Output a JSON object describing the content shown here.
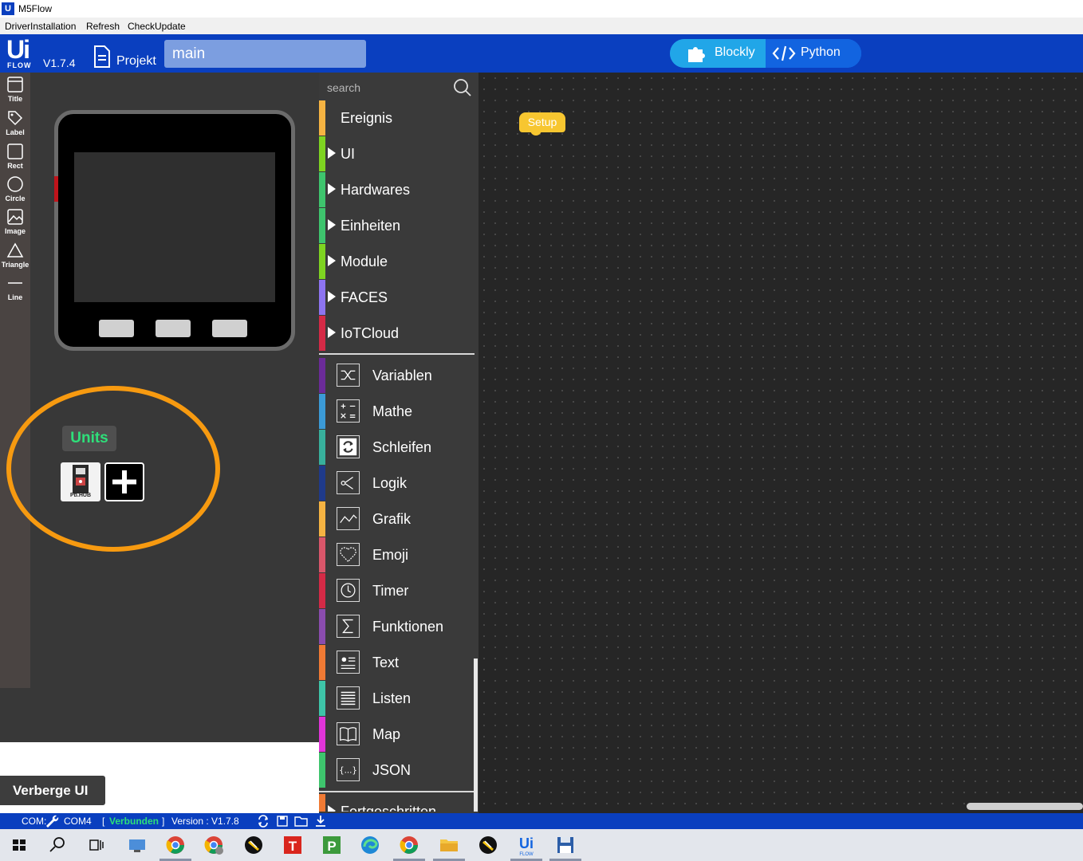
{
  "window": {
    "title": "M5Flow",
    "logo_text": "U"
  },
  "menu": {
    "items": [
      "DriverInstallation",
      "Refresh",
      "CheckUpdate"
    ]
  },
  "header": {
    "logo_big": "Ui",
    "logo_small": "FLOW",
    "version": "V1.7.4",
    "project_label": "Projekt",
    "filename": "main",
    "mode_blockly": "Blockly",
    "mode_python": "Python",
    "active_mode": "Blockly"
  },
  "tools": [
    "Title",
    "Label",
    "Rect",
    "Circle",
    "Image",
    "Triangle",
    "Line"
  ],
  "preview": {
    "units_label": "Units",
    "unit_pbhub_label": "Pb.HUB",
    "hide_ui": "Verberge UI"
  },
  "categories": {
    "search_placeholder": "search",
    "top": [
      {
        "label": "Ereignis",
        "color": "#f5b342",
        "expandable": false
      },
      {
        "label": "UI",
        "color": "#7ed321",
        "expandable": true
      },
      {
        "label": "Hardwares",
        "color": "#3ec46d",
        "expandable": true
      },
      {
        "label": "Einheiten",
        "color": "#3ec46d",
        "expandable": true
      },
      {
        "label": "Module",
        "color": "#7ed321",
        "expandable": true
      },
      {
        "label": "FACES",
        "color": "#8d74f0",
        "expandable": true
      },
      {
        "label": "IoTCloud",
        "color": "#d42a46",
        "expandable": true
      }
    ],
    "bottom": [
      {
        "label": "Variablen",
        "color": "#6b2b99",
        "icon": "variable-icon"
      },
      {
        "label": "Mathe",
        "color": "#3b9ad6",
        "icon": "math-icon"
      },
      {
        "label": "Schleifen",
        "color": "#38b09c",
        "icon": "loop-icon"
      },
      {
        "label": "Logik",
        "color": "#1f3a8a",
        "icon": "logic-icon"
      },
      {
        "label": "Grafik",
        "color": "#f5b342",
        "icon": "graph-icon"
      },
      {
        "label": "Emoji",
        "color": "#d9566a",
        "icon": "heart-icon"
      },
      {
        "label": "Timer",
        "color": "#d42a46",
        "icon": "clock-icon"
      },
      {
        "label": "Funktionen",
        "color": "#8a4cae",
        "icon": "sigma-icon"
      },
      {
        "label": "Text",
        "color": "#f07a34",
        "icon": "text-icon"
      },
      {
        "label": "Listen",
        "color": "#3ec4a8",
        "icon": "list-icon"
      },
      {
        "label": "Map",
        "color": "#e034d8",
        "icon": "book-icon"
      },
      {
        "label": "JSON",
        "color": "#3ec46d",
        "icon": "json-icon"
      }
    ],
    "cut_off": {
      "label": "Fortgeschritten",
      "color": "#f07a34"
    }
  },
  "workspace": {
    "setup_block": "Setup"
  },
  "status": {
    "com_label": "COM:",
    "port": "COM4",
    "bracket_open": "[",
    "connection": "Verbunden",
    "bracket_close": "]",
    "version": "Version : V1.7.8"
  },
  "colors": {
    "header_blue": "#0a3fbf",
    "connected_green": "#2ee07a",
    "highlight_orange": "#f79a10",
    "setup_yellow": "#f7c630"
  }
}
